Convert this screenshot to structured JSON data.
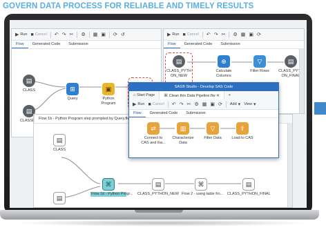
{
  "headline": "GOVERN DATA PROCESS FOR RELIABLE AND TIMELY RESULTS",
  "colors": {
    "headline": "#5aaee0",
    "accent_blue": "#2f6fbf",
    "dashed_highlight": "#e04545",
    "python_node": "#e8b52c",
    "side_stripe": "#3f88c9"
  },
  "pane_left": {
    "toolbar": {
      "run": "Run",
      "cancel": "Cancel",
      "icons": [
        "undo-icon",
        "redo-icon",
        "cut-icon",
        "settings-icon",
        "table-icon",
        "save-icon",
        "refresh-icon"
      ]
    },
    "tabs": [
      "Flow",
      "Generated Code",
      "Submission"
    ],
    "nodes": {
      "class": "CLASS",
      "classfit": "CLASSFIT",
      "query": "Query",
      "python_l1": "Python",
      "python_l2": "Program",
      "cut_label": "CL"
    }
  },
  "pane_right": {
    "toolbar": {
      "run": "Run",
      "cancel": "Cancel"
    },
    "tabs": [
      "Flow",
      "Generated Code",
      "Submission"
    ],
    "nodes": {
      "new_l1": "CLASS_PYTH",
      "new_l2": "ON_NEW",
      "calc_l1": "Calculate",
      "calc_l2": "Columns",
      "filter": "Filter Rows",
      "final_l1": "CLASS_PYTH",
      "final_l2": "ON_FINAL"
    }
  },
  "popup": {
    "title": "SAS® Studio - Develop SAS Code",
    "tabs": [
      "Start Page",
      "Clean this Data Pipeline.flw"
    ],
    "toolbar": {
      "run": "Run",
      "cancel": "Cancel",
      "add": "Add",
      "view": "View"
    },
    "flow_tabs": [
      "Flow",
      "Generated Code",
      "Submission"
    ],
    "nodes": {
      "connect_l1": "Connect to",
      "connect_l2": "CAS and loa...",
      "char_l1": "Characterize",
      "char_l2": "Data",
      "filter": "Filter Data",
      "load": "Load to CAS"
    }
  },
  "pane_bottom": {
    "tab": "Flow 1b - Python Program step prompted by Query.flw",
    "nodes": {
      "class": "CLASS",
      "flow_python": "Flow 1b - Python Progr...",
      "class_new": "CLASS_PYTHON_NEW",
      "flow_long": "Flow 2 - using table fro...",
      "class_final": "CLASS_PYTHON_FINAL"
    }
  }
}
